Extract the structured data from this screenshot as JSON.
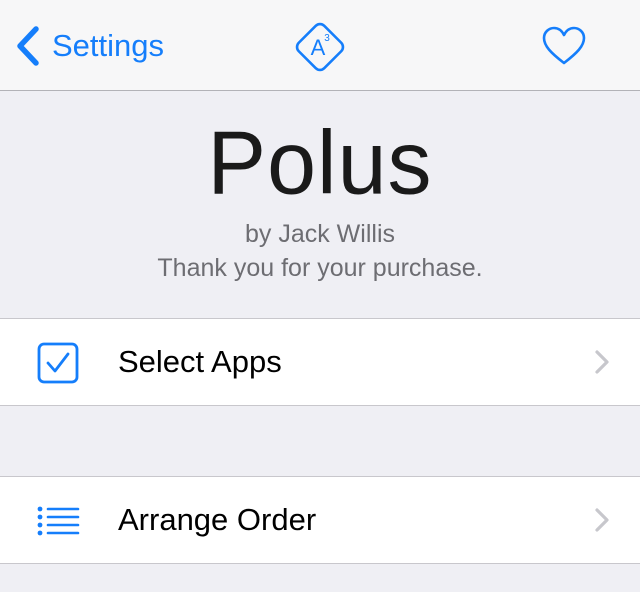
{
  "colors": {
    "accent": "#157efb",
    "background": "#efeff4",
    "navbar": "#f7f7f8",
    "secondary_text": "#6d6d72",
    "chevron": "#c7c7cc"
  },
  "navbar": {
    "back_label": "Settings",
    "back_icon": "chevron-left-icon",
    "logo_icon": "a3-diamond-logo",
    "logo_letter": "A",
    "logo_superscript": "3",
    "favorite_icon": "heart-icon"
  },
  "header": {
    "title": "Polus",
    "author": "by Jack Willis",
    "message": "Thank you for your purchase."
  },
  "list": {
    "items": [
      {
        "label": "Select Apps",
        "icon": "checkbox-icon"
      },
      {
        "label": "Arrange Order",
        "icon": "list-icon"
      }
    ]
  }
}
